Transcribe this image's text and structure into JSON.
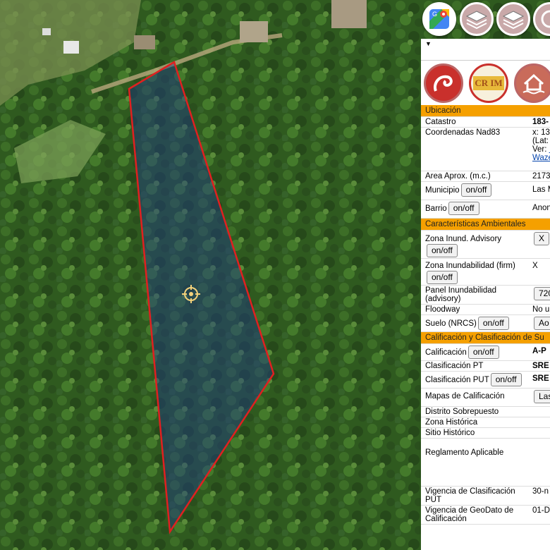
{
  "toolbar": {
    "buttons": [
      {
        "name": "google-maps-button",
        "icon": "google-maps-icon"
      },
      {
        "name": "layers-button",
        "icon": "layers-icon"
      },
      {
        "name": "layers-alt-button",
        "icon": "layers-icon"
      },
      {
        "name": "more-button",
        "icon": "circle-icon"
      }
    ]
  },
  "map": {
    "parcel_outline_color": "#e02020",
    "parcel_fill_color": "#1e3a8a",
    "marker_icon": "crosshair-icon"
  },
  "panel": {
    "collapse_symbol": "▼",
    "logos": [
      "hand-logo",
      "crim-logo",
      "house-flood-logo"
    ],
    "crim_logo_text": "CR IM",
    "ubicacion": {
      "title": "Ubicación",
      "catastro_label": "Catastro",
      "catastro_value": "183-",
      "coordenadas_label": "Coordenadas Nad83",
      "coord_line1": "x: 13",
      "coord_line2": "(Lat:",
      "coord_line3": "Ver: ",
      "coord_link": "Waze",
      "area_label": "Area Aprox. (m.c.)",
      "area_value": "2173",
      "municipio_label": "Municipio",
      "municipio_value": "Las M",
      "barrio_label": "Barrio",
      "barrio_value": "Anon",
      "toggle_label": "on/off"
    },
    "ambientales": {
      "title": "Características Ambientales",
      "zona_advisory_label": "Zona Inund. Advisory",
      "zona_advisory_value": "X",
      "zona_firm_label": "Zona Inundabilidad (firm)",
      "zona_firm_value": "X",
      "panel_label_1": "Panel Inundabilidad",
      "panel_label_2": "(advisory)",
      "panel_value": "720",
      "floodway_label": "Floodway",
      "floodway_value": "No u",
      "suelo_label": "Suelo (NRCS)",
      "suelo_value": "Ao"
    },
    "calificacion": {
      "title": "Calificación y Clasificación de Su",
      "calificacion_label": "Calificación",
      "calificacion_value": "A-P",
      "clasif_pt_label": "Clasificación PT",
      "clasif_pt_value": "SRE",
      "clasif_put_label": "Clasificación PUT",
      "clasif_put_value": "SRE",
      "mapas_label": "Mapas de Calificación",
      "mapas_value": "Las",
      "distrito_label": "Distrito Sobrepuesto",
      "zona_historica_label": "Zona Histórica",
      "sitio_historico_label": "Sitio Histórico",
      "reglamento_label": "Reglamento Aplicable",
      "vigencia_label_1": "Vigencia de Clasificación",
      "vigencia_label_2": "PUT",
      "vigencia_value": "30-n",
      "geodato_label_1": "Vigencia de GeoDato de",
      "geodato_label_2": "Calificación",
      "geodato_value": "01-D"
    }
  }
}
